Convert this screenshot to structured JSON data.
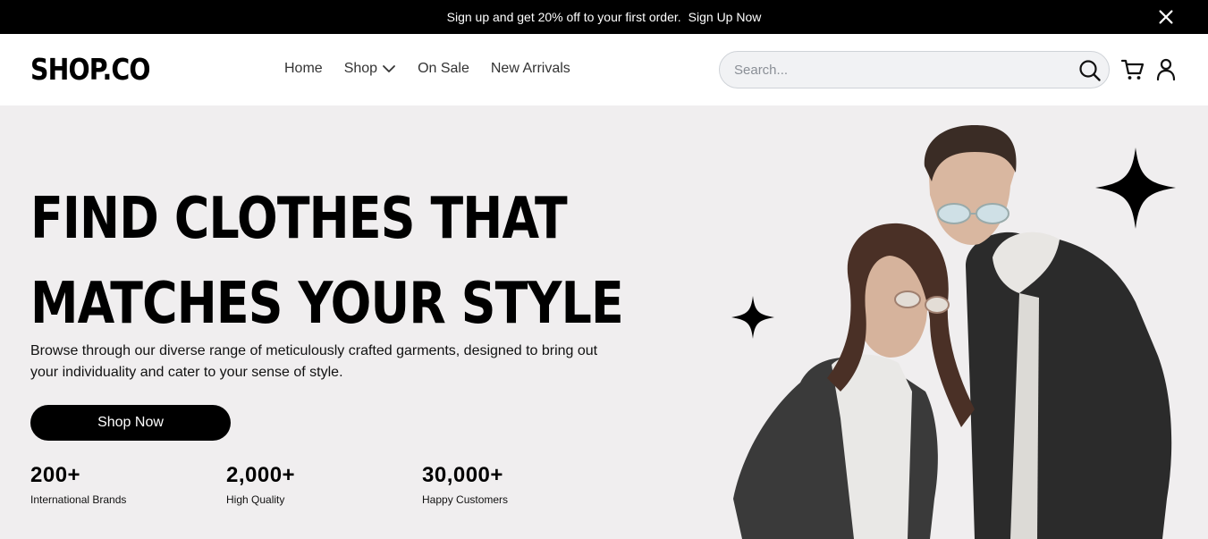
{
  "announcement": {
    "text": "Sign up and get 20% off to your first order.",
    "link_label": "Sign Up Now"
  },
  "header": {
    "logo": "SHOP.CO",
    "nav": [
      "Home",
      "Shop",
      "On Sale",
      "New Arrivals"
    ],
    "search_placeholder": "Search..."
  },
  "hero": {
    "headline_line1": "FIND CLOTHES THAT",
    "headline_line2": "MATCHES YOUR STYLE",
    "description": "Browse through our diverse range of meticulously crafted garments, designed to bring out your individuality and cater to your sense of style.",
    "cta_label": "Shop Now",
    "stats": [
      {
        "value": "200+",
        "label": "International Brands"
      },
      {
        "value": "2,000+",
        "label": "High Quality"
      },
      {
        "value": "30,000+",
        "label": "Happy Customers"
      }
    ]
  },
  "icons": {
    "close": "close-icon",
    "dropdown": "chevron-down-icon",
    "search": "search-icon",
    "cart": "cart-icon",
    "account": "user-icon",
    "sparkle": "sparkle-icon"
  },
  "colors": {
    "announcement_bg": "#000000",
    "hero_bg": "#f0eeef",
    "button_bg": "#000000"
  }
}
